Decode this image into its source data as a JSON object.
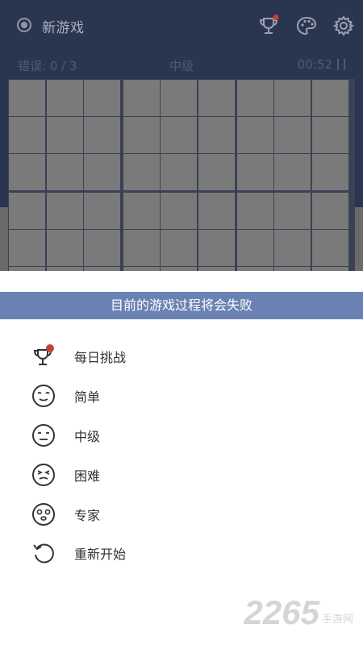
{
  "appbar": {
    "title": "新游戏",
    "icons": [
      "record-icon",
      "trophy-icon",
      "palette-icon",
      "gear-icon"
    ],
    "notification_color": "#c0403a"
  },
  "status": {
    "mistakes": "错误: 0 / 3",
    "level": "中级",
    "timer": "00:52"
  },
  "banner": {
    "text": "目前的游戏过程将会失败"
  },
  "menu": {
    "items": [
      {
        "label": "每日挑战",
        "icon": "trophy-icon"
      },
      {
        "label": "简单",
        "icon": "face-easy-icon"
      },
      {
        "label": "中级",
        "icon": "face-medium-icon"
      },
      {
        "label": "困难",
        "icon": "face-hard-icon"
      },
      {
        "label": "专家",
        "icon": "face-expert-icon"
      },
      {
        "label": "重新开始",
        "icon": "restart-icon"
      }
    ]
  },
  "watermark": {
    "brand": "2265",
    "site": "手游网"
  },
  "colors": {
    "bar": "#2a3550",
    "banner": "#6982b3",
    "cell": "#7a7a7a"
  }
}
